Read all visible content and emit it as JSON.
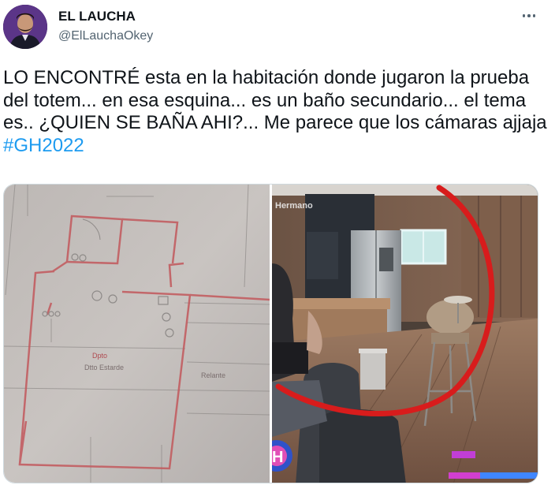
{
  "author": {
    "display_name": "EL LAUCHA",
    "handle": "@ElLauchaOkey"
  },
  "tweet": {
    "text_before": "LO ENCONTRÉ esta en la habitación donde jugaron la prueba del totem... en esa esquina... es un baño secundario... el tema es.. ¿QUIEN SE BAÑA AHI?... Me parece que los cámaras ajjaja ",
    "hashtag": "#GH2022"
  },
  "media": {
    "left_photo": {
      "label_1": "Dpto",
      "label_2": "Dtto Estarde",
      "label_3": "Relante"
    },
    "right_photo": {
      "watermark": "Hermano"
    }
  },
  "icons": {
    "more": "more-horizontal-icon"
  },
  "colors": {
    "text_primary": "#0f1419",
    "text_secondary": "#536471",
    "link": "#1d9bf0",
    "border": "#cfd9de",
    "annotation_circle": "#d81c1c"
  }
}
